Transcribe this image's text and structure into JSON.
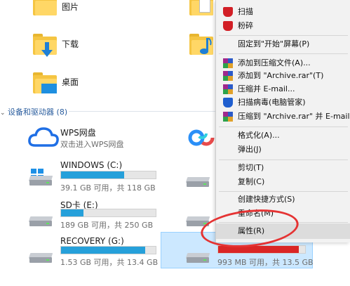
{
  "folders": [
    {
      "label": "图片"
    },
    {
      "label": "下载"
    },
    {
      "label": "桌面"
    }
  ],
  "section": {
    "title": "设备和驱动器 (8)"
  },
  "devices": {
    "wps": {
      "name": "WPS网盘",
      "sub": "双击进入WPS网盘"
    }
  },
  "drives": [
    {
      "name": "WINDOWS (C:)",
      "info": "39.1 GB 可用，共 118 GB",
      "used_fraction": 0.67
    },
    {
      "name": "SD卡 (E:)",
      "info": "189 GB 可用，共 250 GB",
      "used_fraction": 0.24
    },
    {
      "name": "RECOVERY (G:)",
      "info": "1.53 GB 可用，共 13.4 GB",
      "used_fraction": 0.89
    },
    {
      "name": "",
      "info": "993 MB 可用，共 13.5 GB",
      "used_fraction": 0.93
    }
  ],
  "menu": {
    "items": [
      {
        "label": "扫描"
      },
      {
        "label": "粉碎"
      },
      {
        "label": "固定到\"开始\"屏幕(P)"
      },
      {
        "label": "添加到压缩文件(A)..."
      },
      {
        "label": "添加到 \"Archive.rar\"(T)"
      },
      {
        "label": "压缩并 E-mail..."
      },
      {
        "label": "扫描病毒(电脑管家)"
      },
      {
        "label": "压缩到 \"Archive.rar\" 并 E-mail"
      },
      {
        "label": "格式化(A)..."
      },
      {
        "label": "弹出(J)"
      },
      {
        "label": "剪切(T)"
      },
      {
        "label": "复制(C)"
      },
      {
        "label": "创建快捷方式(S)"
      },
      {
        "label": "重命名(M)"
      },
      {
        "label": "属性(R)"
      }
    ]
  },
  "colors": {
    "accent_bar": "#26a0da",
    "low_space_bar": "#da2626",
    "selection": "#cce8ff",
    "annotation": "#e53333"
  }
}
